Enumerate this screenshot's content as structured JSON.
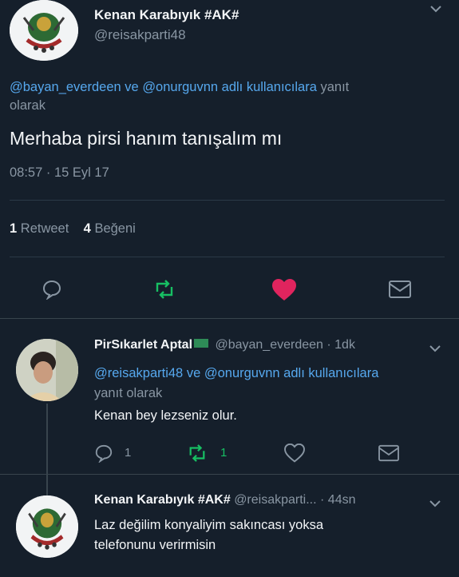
{
  "main_tweet": {
    "author_name": "Kenan Karabıyık #AK#",
    "author_handle": "@reisakparti48",
    "reply_to_user1": "@bayan_everdeen",
    "reply_to_ve": "ve",
    "reply_to_user2": "@onurguvnn",
    "reply_to_tail": "adlı kullanıcılara",
    "reply_to_suffix": "yanıt",
    "reply_to_suffix2": "olarak",
    "text": "Merhaba pirsi hanım tanışalım mı",
    "timestamp": "08:57 · 15 Eyl 17",
    "retweet_count": "1",
    "retweet_label": "Retweet",
    "like_count": "4",
    "like_label": "Beğeni"
  },
  "reply1": {
    "author_name": "PirSıkarlet Aptal",
    "author_flag": "🇸🇦",
    "author_handle": "@bayan_everdeen",
    "time": "· 1dk",
    "reply_line1_user1": "@reisakparti48",
    "reply_line1_ve": "ve",
    "reply_line1_user2": "@onurguvnn",
    "reply_line1_tail": "adlı kullanıcılara",
    "reply_line2": "yanıt olarak",
    "text": "Kenan bey lezseniz olur.",
    "reply_count": "1",
    "retweet_count": "1"
  },
  "reply2": {
    "author_name": "Kenan Karabıyık #AK#",
    "author_handle": "@reisakparti...",
    "time": "· 44sn",
    "text_line1": "Laz değilim konyaliyim sakıncası yoksa",
    "text_line2": "telefonunu verirmisin"
  },
  "colors": {
    "background": "#151f2b",
    "link": "#56a8ee",
    "muted": "#8996a3",
    "like": "#e0245e",
    "retweet": "#17bf63"
  },
  "icons": {
    "main_chevron": "chevron-down-icon",
    "reply": "comment-icon",
    "retweet": "retweet-icon",
    "like": "heart-icon",
    "dm": "envelope-icon"
  }
}
